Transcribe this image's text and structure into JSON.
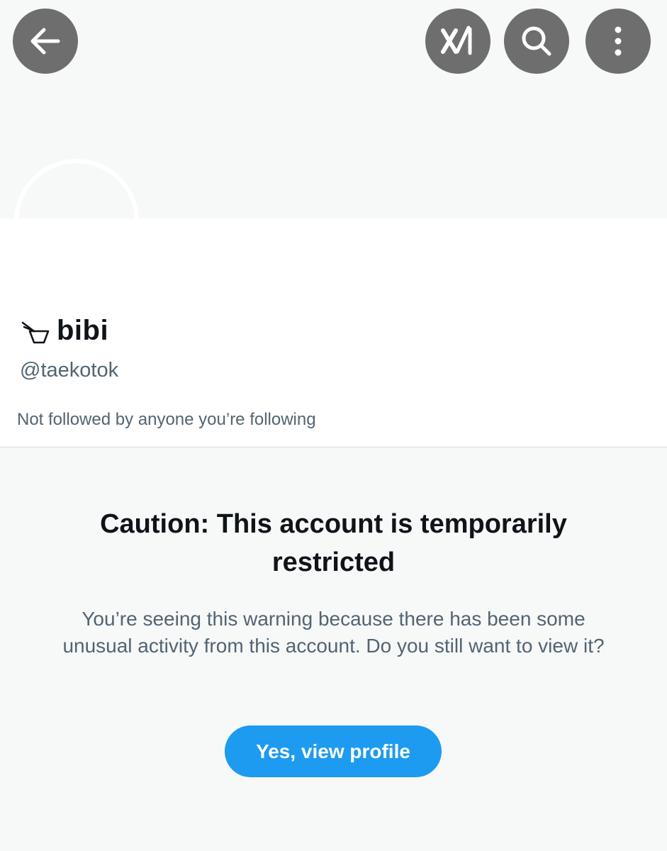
{
  "header": {
    "back_icon": "arrow-left-icon",
    "grok_icon": "grok-icon",
    "search_icon": "search-icon",
    "more_icon": "more-vertical-icon",
    "button_color": "#6e6e6e"
  },
  "profile": {
    "name_emoji_icon": "chopsticks-bowl-icon",
    "display_name": "bibi",
    "handle": "@taekotok",
    "followers_note": "Not followed by anyone you’re following"
  },
  "warning": {
    "title": "Caution: This account is temporarily restricted",
    "body": "You’re seeing this warning because there has been some unusual activity from this account. Do you still want to view it?",
    "button_label": "Yes, view profile",
    "button_color": "#1d9bf0"
  }
}
